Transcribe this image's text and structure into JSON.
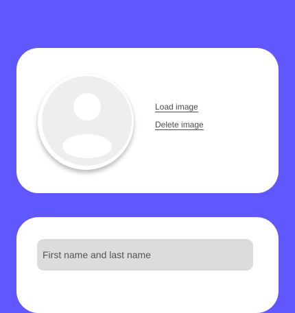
{
  "avatar_card": {
    "load_image_label": "Load image",
    "delete_image_label": "Delete image"
  },
  "form_card": {
    "name_field": {
      "placeholder": "First name and last name",
      "value": ""
    }
  },
  "colors": {
    "background": "#6157ff",
    "card": "#ffffff",
    "avatar_placeholder": "#eeeeee",
    "input_background": "#dcdcdc",
    "link_text": "#4a4a4a"
  },
  "icons": {
    "avatar": "user-placeholder-icon"
  }
}
